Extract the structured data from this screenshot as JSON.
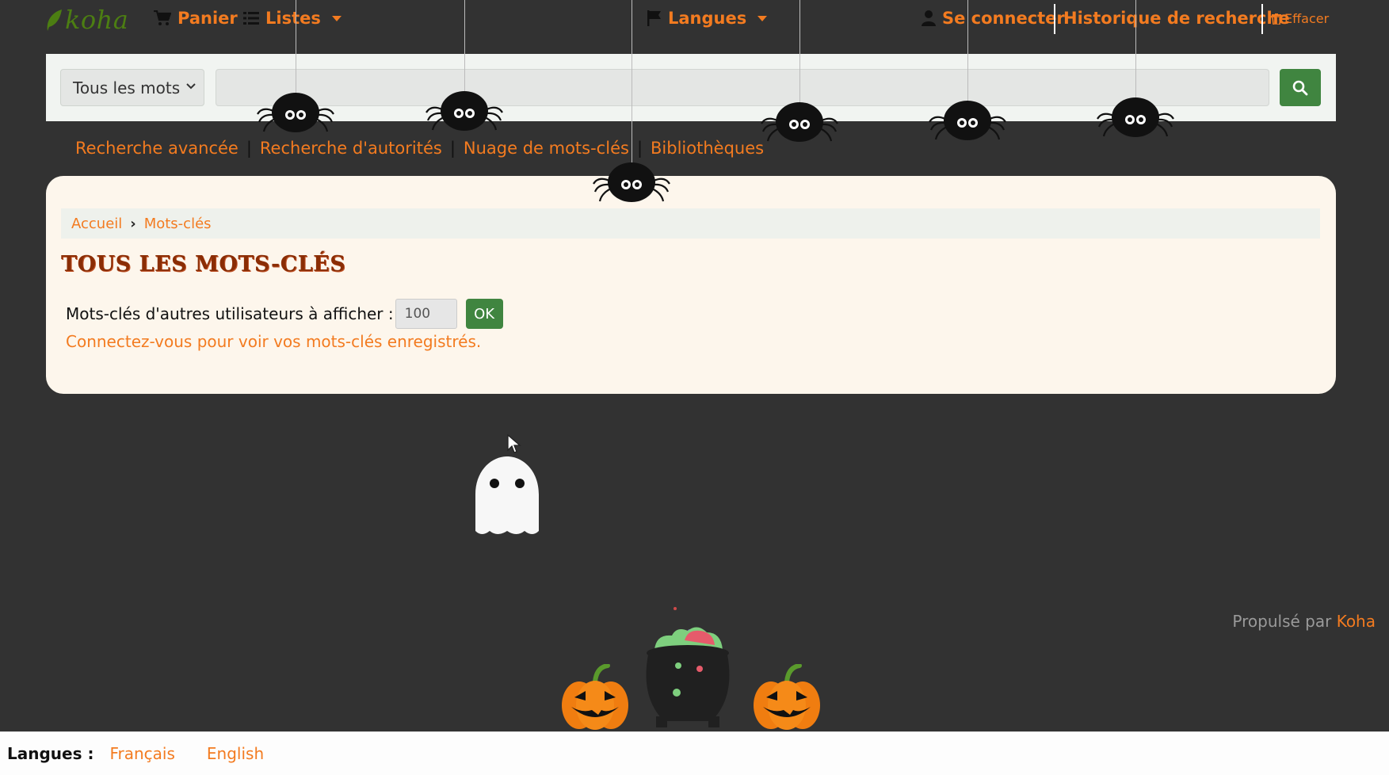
{
  "nav": {
    "logo": "koha",
    "cart": "Panier",
    "lists": "Listes",
    "languages": "Langues",
    "login": "Se connecter",
    "history": "Historique de recherche",
    "clear": "Effacer"
  },
  "search": {
    "scope_selected": "Tous les mots",
    "query_value": ""
  },
  "more_searches": [
    "Recherche avancée",
    "Recherche d'autorités",
    "Nuage de mots-clés",
    "Bibliothèques"
  ],
  "breadcrumb": {
    "home": "Accueil",
    "current": "Mots-clés"
  },
  "page": {
    "title": "TOUS LES MOTS-CLÉS",
    "tags_label": "Mots-clés d'autres utilisateurs à afficher :",
    "tags_count": "100",
    "ok": "OK",
    "login_hint": "Connectez-vous pour voir vos mots-clés enregistrés."
  },
  "footer": {
    "powered_by": "Propulsé par",
    "koha_link": "Koha"
  },
  "langbar": {
    "label": "Langues :",
    "french": "Français",
    "english": "English"
  },
  "colors": {
    "accent": "#f37b20",
    "button_green": "#408540",
    "background": "#323232",
    "panel": "#fdf6ec",
    "title": "#8a2d05"
  },
  "icons": {
    "cart": "shopping-cart-icon",
    "lists": "list-icon",
    "languages": "flag-icon",
    "login": "user-icon",
    "clear": "trash-icon",
    "search": "search-icon"
  }
}
